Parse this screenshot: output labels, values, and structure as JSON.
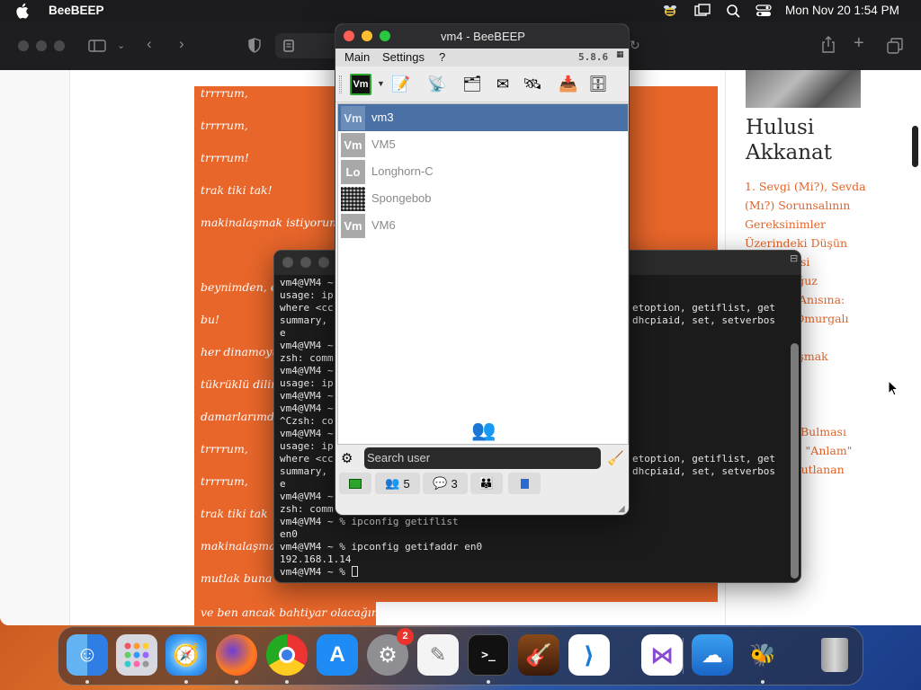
{
  "menubar": {
    "app_name": "BeeBEEP",
    "clock": "Mon Nov 20  1:54 PM"
  },
  "poem": {
    "lines": [
      "trrrrum,",
      "trrrrum,",
      "trrrrum!",
      "trak tiki tak!",
      "makinalaşmak istiyorum",
      "beynimden, e",
      "bu!",
      "her dinamoyu",
      "tükrüklü dilin",
      "damarlarımd",
      "trrrrum,",
      "trrrrum,",
      "trak tiki tak",
      "makinalaşma",
      "mutlak buna",
      "ve ben ancak bahtiyar olacağım"
    ]
  },
  "sidebar": {
    "author_name": "Hulusi Akkanat",
    "links": [
      "1. Sevgi (Mi?), Sevda",
      "(Mı?) Sorunsalının",
      "Gereksinimler",
      "Üzerindeki Düşün",
      "si",
      "Oğuz",
      "n Anısına:",
      "i Omurgalı",
      "laşmak",
      "s",
      "Bulması",
      "on \"Anlam\"",
      "oyutlanan"
    ]
  },
  "terminal": {
    "lines": [
      "vm4@VM4 ~",
      "usage: ip",
      "where <cc",
      "summary,",
      "e",
      "vm4@VM4 ~",
      "zsh: comm",
      "vm4@VM4 ~",
      "usage: ip",
      "vm4@VM4 ~",
      "vm4@VM4 ~",
      "^Czsh: co",
      "vm4@VM4 ~",
      "usage: ip",
      "where <cc",
      "summary,",
      "e",
      "vm4@VM4 ~",
      "zsh: comm",
      "vm4@VM4 ~ % ipconfig getiflist",
      "en0",
      "vm4@VM4 ~ % ipconfig getifaddr en0",
      "192.168.1.14",
      "vm4@VM4 ~ % "
    ],
    "right_fragments": [
      "etoption, getiflist, get",
      "dhcpiaid, set, setverbos",
      "etoption, getiflist, get",
      "dhcpiaid, set, setverbos"
    ]
  },
  "beebeep": {
    "title": "vm4 - BeeBEEP",
    "menu": [
      "Main",
      "Settings",
      "?"
    ],
    "version": "5.8.6",
    "users": [
      {
        "avatar": "Vm",
        "name": "vm3",
        "selected": true
      },
      {
        "avatar": "Vm",
        "name": "VM5",
        "selected": false
      },
      {
        "avatar": "Lo",
        "name": "Longhorn-C",
        "selected": false
      },
      {
        "avatar": "",
        "name": "Spongebob",
        "selected": false
      },
      {
        "avatar": "Vm",
        "name": "VM6",
        "selected": false
      }
    ],
    "search_placeholder": "Search user",
    "status": {
      "users_count": "5",
      "chats_count": "3"
    },
    "toolbar_status_label": "Vm"
  },
  "dock": {
    "badge_settings": "2",
    "apps": [
      "finder-icon",
      "launchpad-icon",
      "safari-icon",
      "firefox-icon",
      "chrome-icon",
      "app-store-icon",
      "system-settings-icon",
      "textedit-icon",
      "terminal-icon",
      "garageband-icon",
      "vscode-icon",
      "visual-studio-icon",
      "cloud-app-icon",
      "beebeep-icon",
      "trash-icon"
    ]
  },
  "colors": {
    "poem_bg": "#e8662a",
    "link": "#e0652a",
    "selection": "#4a71a6",
    "accent_green": "#2aa52a"
  }
}
